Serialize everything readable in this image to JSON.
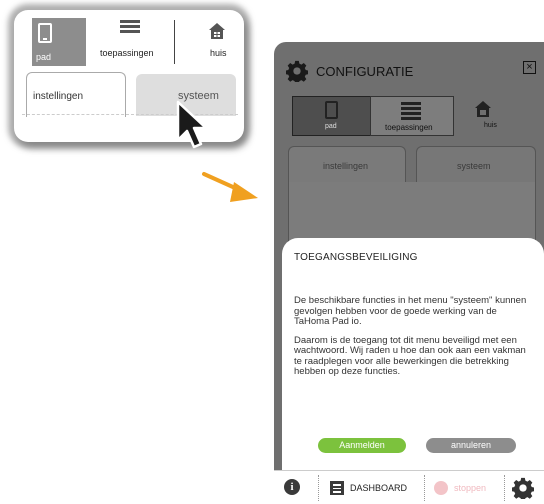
{
  "inset": {
    "tab_pad_label": "pad",
    "tab_apps_label": "toepassingen",
    "tab_home_label": "huis",
    "subtab_settings_label": "instellingen",
    "subtab_system_label": "systeem"
  },
  "window": {
    "title": "CONFIGURATIE",
    "close_label": "×",
    "tabs": [
      {
        "label": "pad",
        "icon": "phone-icon"
      },
      {
        "label": "toepassingen",
        "icon": "list-icon"
      },
      {
        "label": "huis",
        "icon": "house-icon"
      }
    ],
    "subtabs": [
      {
        "label": "instellingen"
      },
      {
        "label": "systeem"
      }
    ]
  },
  "dialog": {
    "title": "TOEGANGSBEVEILIGING",
    "paragraph1": "De beschikbare functies in het menu \"systeem\" kunnen gevolgen hebben voor de goede werking van de TaHoma Pad io.",
    "paragraph2": "Daarom is de toegang tot dit menu beveiligd met een wachtwoord. Wij raden u hoe dan ook aan een vakman te raadplegen voor alle bewerkingen die betrekking hebben op deze functies.",
    "confirm_label": "Aanmelden",
    "cancel_label": "annuleren"
  },
  "bottom_bar": {
    "info_label": "i",
    "dashboard_label": "DASHBOARD",
    "stop_label": "stoppen"
  },
  "colors": {
    "confirm": "#7cc23d",
    "cancel": "#8d8d8d",
    "arrow": "#f0a020",
    "stop": "#f3c4c8"
  }
}
